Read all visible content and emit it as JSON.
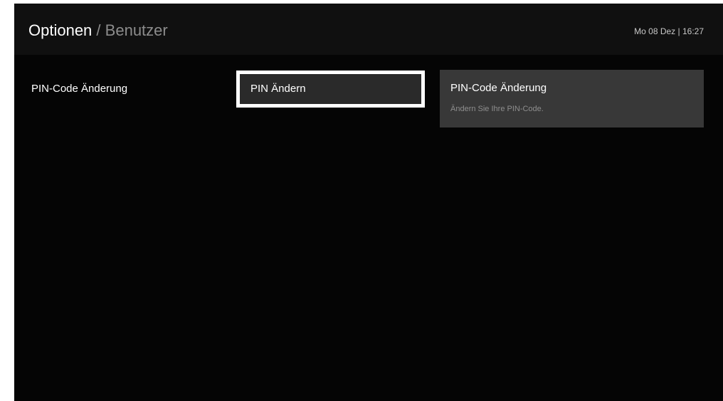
{
  "header": {
    "breadcrumb": {
      "title": "Optionen",
      "separator": "/",
      "subtitle": "Benutzer"
    },
    "clock": "Mo 08 Dez | 16:27"
  },
  "menu": {
    "category": "PIN-Code Änderung"
  },
  "options": {
    "selected_label": "PIN Ändern"
  },
  "info": {
    "title": "PIN-Code Änderung",
    "description": "Ändern Sie Ihre PIN-Code."
  },
  "colors": {
    "background": "#050505",
    "header": "#101010",
    "focus_border": "#ffffff",
    "panel": "#383838",
    "muted_text": "#8c8c8c"
  }
}
